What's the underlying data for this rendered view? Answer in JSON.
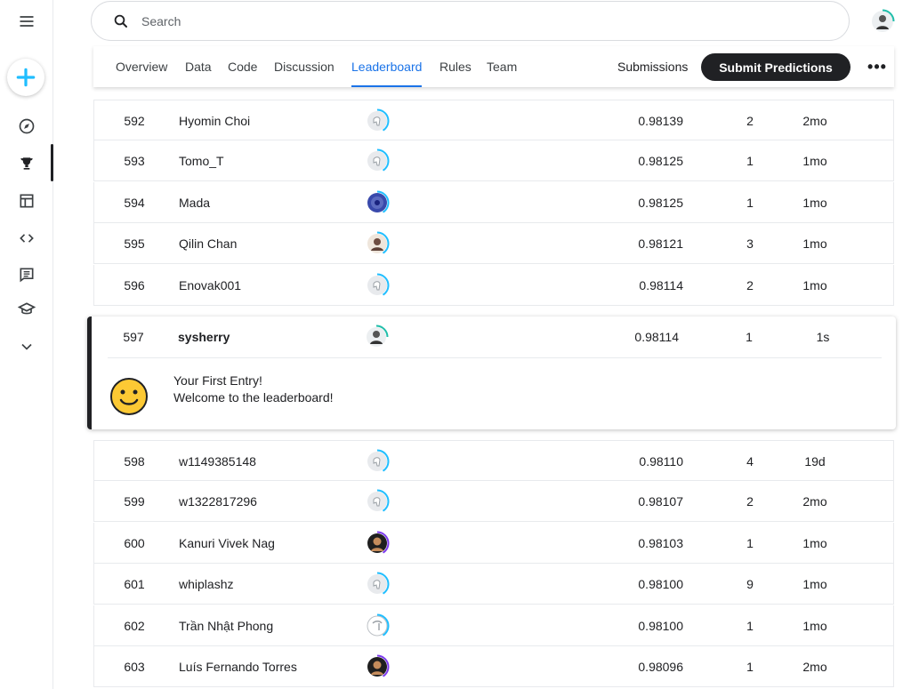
{
  "search": {
    "placeholder": "Search"
  },
  "nav": {
    "tabs": [
      {
        "label": "Overview"
      },
      {
        "label": "Data"
      },
      {
        "label": "Code"
      },
      {
        "label": "Discussion"
      },
      {
        "label": "Leaderboard"
      },
      {
        "label": "Rules"
      },
      {
        "label": "Team"
      }
    ],
    "active_tab": "Leaderboard",
    "submissions_label": "Submissions",
    "submit_label": "Submit Predictions",
    "more_label": "•••"
  },
  "rail": {
    "icons": [
      "menu-icon",
      "create-icon",
      "compass-icon",
      "trophy-icon",
      "table-icon",
      "code-icon",
      "comment-icon",
      "school-icon",
      "chevron-down-icon"
    ]
  },
  "leaderboard": {
    "rows_before": [
      {
        "rank": "592",
        "name": "Hyomin Choi",
        "score": "0.98139",
        "entries": "2",
        "last": "2mo",
        "avatar": "default",
        "ring": "#20beff"
      },
      {
        "rank": "593",
        "name": "Tomo_T",
        "score": "0.98125",
        "entries": "1",
        "last": "1mo",
        "avatar": "default",
        "ring": "#20beff"
      },
      {
        "rank": "594",
        "name": "Mada",
        "score": "0.98125",
        "entries": "1",
        "last": "1mo",
        "avatar": "blue",
        "ring": "#20beff"
      },
      {
        "rank": "595",
        "name": "Qilin Chan",
        "score": "0.98121",
        "entries": "3",
        "last": "1mo",
        "avatar": "photo",
        "ring": "#20beff"
      },
      {
        "rank": "596",
        "name": "Enovak001",
        "score": "0.98114",
        "entries": "2",
        "last": "1mo",
        "avatar": "default",
        "ring": "#20beff"
      }
    ],
    "current": {
      "rank": "597",
      "name": "sysherry",
      "score": "0.98114",
      "entries": "1",
      "last": "1s",
      "avatar": "photo",
      "ring": "#20beff"
    },
    "welcome": {
      "line1": "Your First Entry!",
      "line2": "Welcome to the leaderboard!"
    },
    "rows_after": [
      {
        "rank": "598",
        "name": "w1149385148",
        "score": "0.98110",
        "entries": "4",
        "last": "19d",
        "avatar": "default",
        "ring": "#20beff"
      },
      {
        "rank": "599",
        "name": "w1322817296",
        "score": "0.98107",
        "entries": "2",
        "last": "2mo",
        "avatar": "default",
        "ring": "#20beff"
      },
      {
        "rank": "600",
        "name": "Kanuri Vivek Nag",
        "score": "0.98103",
        "entries": "1",
        "last": "1mo",
        "avatar": "dark",
        "ring": "#7c3aed"
      },
      {
        "rank": "601",
        "name": "whiplashz",
        "score": "0.98100",
        "entries": "9",
        "last": "1mo",
        "avatar": "default",
        "ring": "#20beff"
      },
      {
        "rank": "602",
        "name": "Trần Nhật Phong",
        "score": "0.98100",
        "entries": "1",
        "last": "1mo",
        "avatar": "outline",
        "ring": "#20beff"
      },
      {
        "rank": "603",
        "name": "Luís Fernando Torres",
        "score": "0.98096",
        "entries": "1",
        "last": "2mo",
        "avatar": "dark",
        "ring": "#7c3aed"
      }
    ]
  },
  "colors": {
    "accent": "#1a73e8",
    "dark": "#202124",
    "ring_green": "#20beaa",
    "ring_blue": "#20beff",
    "ring_purple": "#7c3aed"
  }
}
